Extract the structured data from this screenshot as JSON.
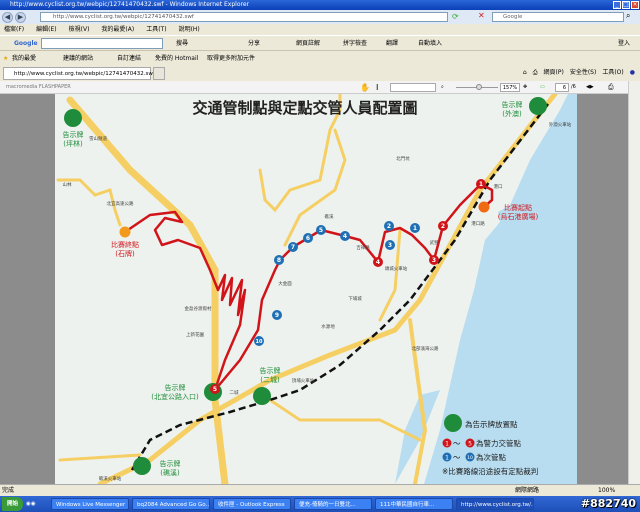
{
  "window": {
    "title": "http://www.cyclist.org.tw/webpic/12741470432.swf - Windows Internet Explorer"
  },
  "address": {
    "url": "http://www.cyclist.org.tw/webpic/12741470432.swf",
    "search_placeholder": "Google"
  },
  "menu": [
    "檔案(F)",
    "編輯(E)",
    "檢視(V)",
    "我的最愛(A)",
    "工具(T)",
    "說明(H)"
  ],
  "google_bar": {
    "logo": "Google",
    "search": "搜尋",
    "share": "分享",
    "notes": "網頁註解",
    "spell": "拼字檢查",
    "translate": "翻譯",
    "autofill": "自動填入",
    "login": "登入"
  },
  "favorites": {
    "label": "我的最愛",
    "items": [
      "建議的網站",
      "自訂連結",
      "免費的 Hotmail",
      "取得更多附加元件"
    ]
  },
  "tab": {
    "label": "http://www.cyclist.org.tw/webpic/12741470432.swf"
  },
  "commands": [
    "網頁(P)",
    "安全性(S)",
    "工具(O)"
  ],
  "flashpaper": {
    "brand": "macromedia FLASHPAPER",
    "zoom": "157%",
    "page": "6",
    "page_total": "/6"
  },
  "map": {
    "title": "交通管制點與定點交管人員配置圖",
    "signs": [
      {
        "label": "告示牌",
        "sub": "(坪林)"
      },
      {
        "label": "告示牌",
        "sub": "(外澳)"
      },
      {
        "label": "告示牌",
        "sub": "(北宜公路入口)"
      },
      {
        "label": "告示牌",
        "sub": "(二城)"
      },
      {
        "label": "告示牌",
        "sub": "(礁溪)"
      }
    ],
    "finish": {
      "label": "比賽終點",
      "sub": "(石牌)"
    },
    "start": {
      "label": "比賽起點",
      "sub": "(烏石港廣場)"
    },
    "red_points": [
      "1",
      "2",
      "3",
      "4",
      "5"
    ],
    "blue_points": [
      "1",
      "2",
      "3",
      "4",
      "5",
      "6",
      "7",
      "8",
      "9",
      "10"
    ],
    "places": [
      "山林",
      "北門坑",
      "礁溪",
      "吉祥路",
      "頭城火車站",
      "武營",
      "港口",
      "港口路",
      "外澳火車站",
      "大金面",
      "金盈谷渡假村",
      "上新花園",
      "水源地",
      "二城",
      "頂埔火車站",
      "礁溪火車站",
      "下埔城",
      "北部濱海公路",
      "北宜高速公路",
      "雪山隧道"
    ],
    "legend": {
      "green": "為告示牌放置點",
      "red_from": "1",
      "red_to": "5",
      "red": "為警力交管點",
      "blue_from": "1",
      "blue_to": "10",
      "blue": "為次管點",
      "tilde": "～",
      "note": "※比賽路線沿途設有定點裁判"
    },
    "colors": {
      "route": "#d0141a",
      "sign": "#1e8c3a",
      "blue": "#1f6fb4",
      "sea": "#b8ddf0",
      "road": "#f5cf63"
    }
  },
  "status": {
    "text": "完成",
    "zone": "網際網路",
    "zoom": "100%"
  },
  "taskbar": {
    "start": "開始",
    "tasks": [
      "Windows Live Messenger",
      "bq2084 Advanced Go Go...",
      "收件匣 - Outlook Express",
      "便充-倚騎的一日雙北...",
      "111中華民國自行車...",
      "http://www.cyclist.org.tw/..."
    ]
  },
  "watermark": "#882740"
}
